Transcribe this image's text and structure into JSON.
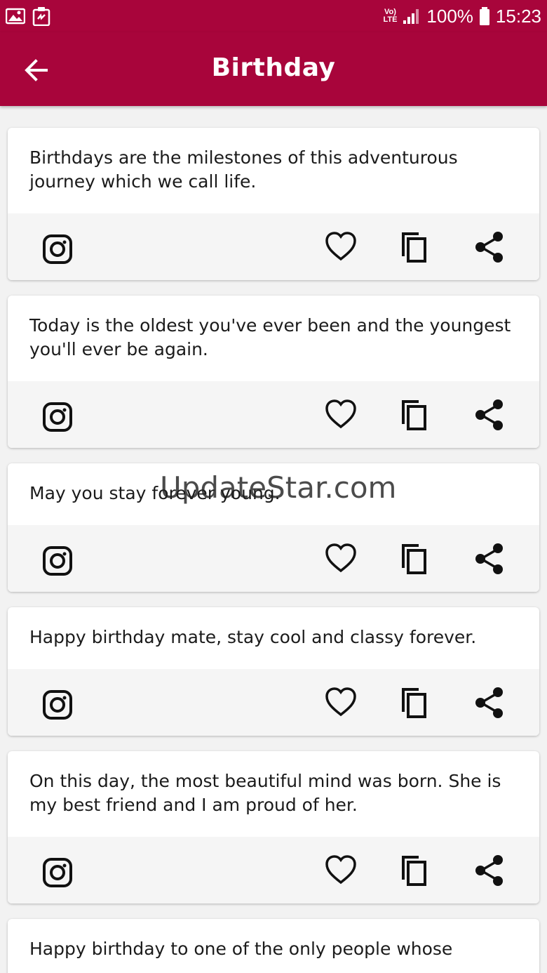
{
  "status_bar": {
    "network": "LTE",
    "volte": "Vo)",
    "battery": "100%",
    "time": "15:23"
  },
  "app_bar": {
    "title": "Birthday"
  },
  "quotes": [
    {
      "text": "Birthdays are the milestones of this adventurous journey which we call life."
    },
    {
      "text": "Today is the oldest you've ever been and the youngest you'll ever be again."
    },
    {
      "text": "May you stay forever young."
    },
    {
      "text": "Happy birthday mate, stay cool and classy forever."
    },
    {
      "text": "On this day, the most beautiful mind was born. She is my best friend and I am proud of her."
    },
    {
      "text": "Happy birthday to one of the only people whose"
    }
  ],
  "watermark": "UpdateStar.com",
  "colors": {
    "primary": "#a8053b",
    "card_bg": "#ffffff",
    "action_bg": "#f5f5f5",
    "page_bg": "#f2f2f2"
  },
  "icons": [
    "back-arrow-icon",
    "instagram-icon",
    "heart-icon",
    "copy-icon",
    "share-icon"
  ]
}
